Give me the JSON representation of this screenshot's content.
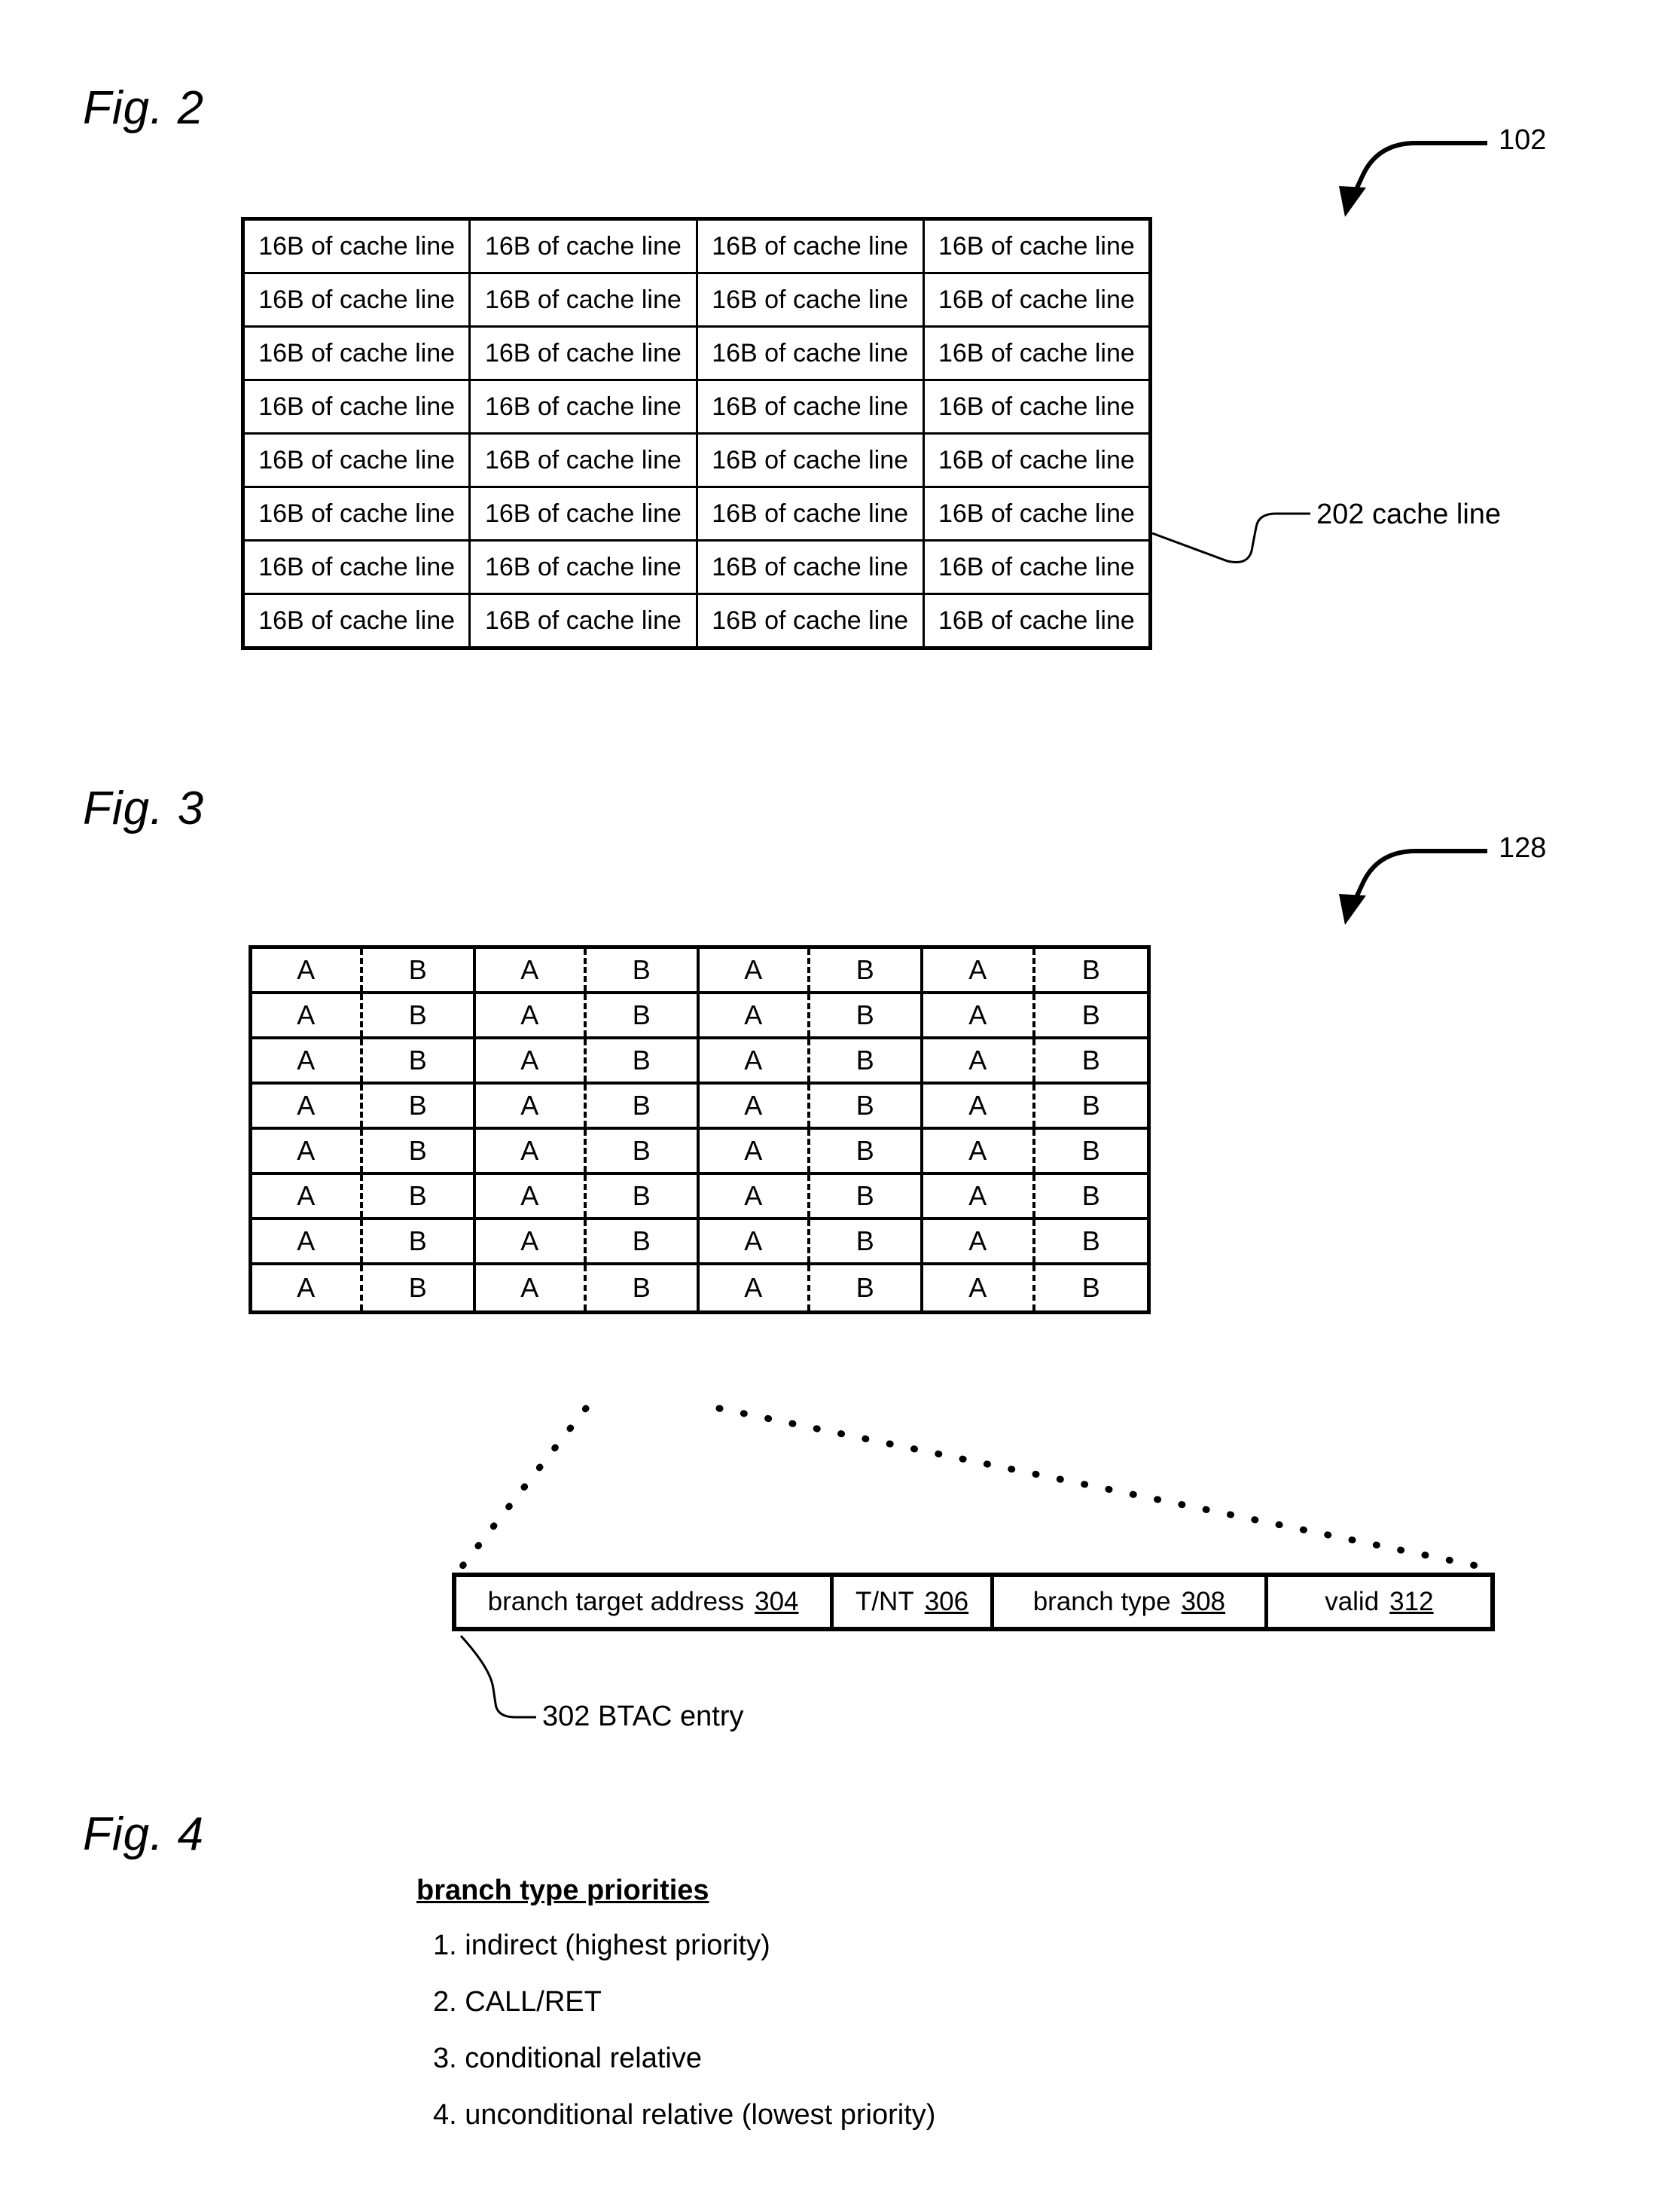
{
  "figures": {
    "fig2": {
      "label": "Fig. 2",
      "ref": "102",
      "callout": "202 cache line",
      "rows": 8,
      "cols": 4,
      "cell_text": "16B of cache line"
    },
    "fig3": {
      "label": "Fig. 3",
      "ref": "128",
      "callout": "302 BTAC entry",
      "rows": 8,
      "pairs_per_row": 4,
      "way_a": "A",
      "way_b": "B",
      "entry_fields": [
        {
          "name": "branch target address",
          "num": "304"
        },
        {
          "name": "T/NT",
          "num": "306"
        },
        {
          "name": "branch type",
          "num": "308"
        },
        {
          "name": "valid",
          "num": "312"
        }
      ]
    },
    "fig4": {
      "label": "Fig. 4",
      "heading": "branch type priorities",
      "items": [
        "1. indirect (highest priority)",
        "2. CALL/RET",
        "3. conditional relative",
        "4. unconditional relative (lowest priority)"
      ]
    }
  }
}
